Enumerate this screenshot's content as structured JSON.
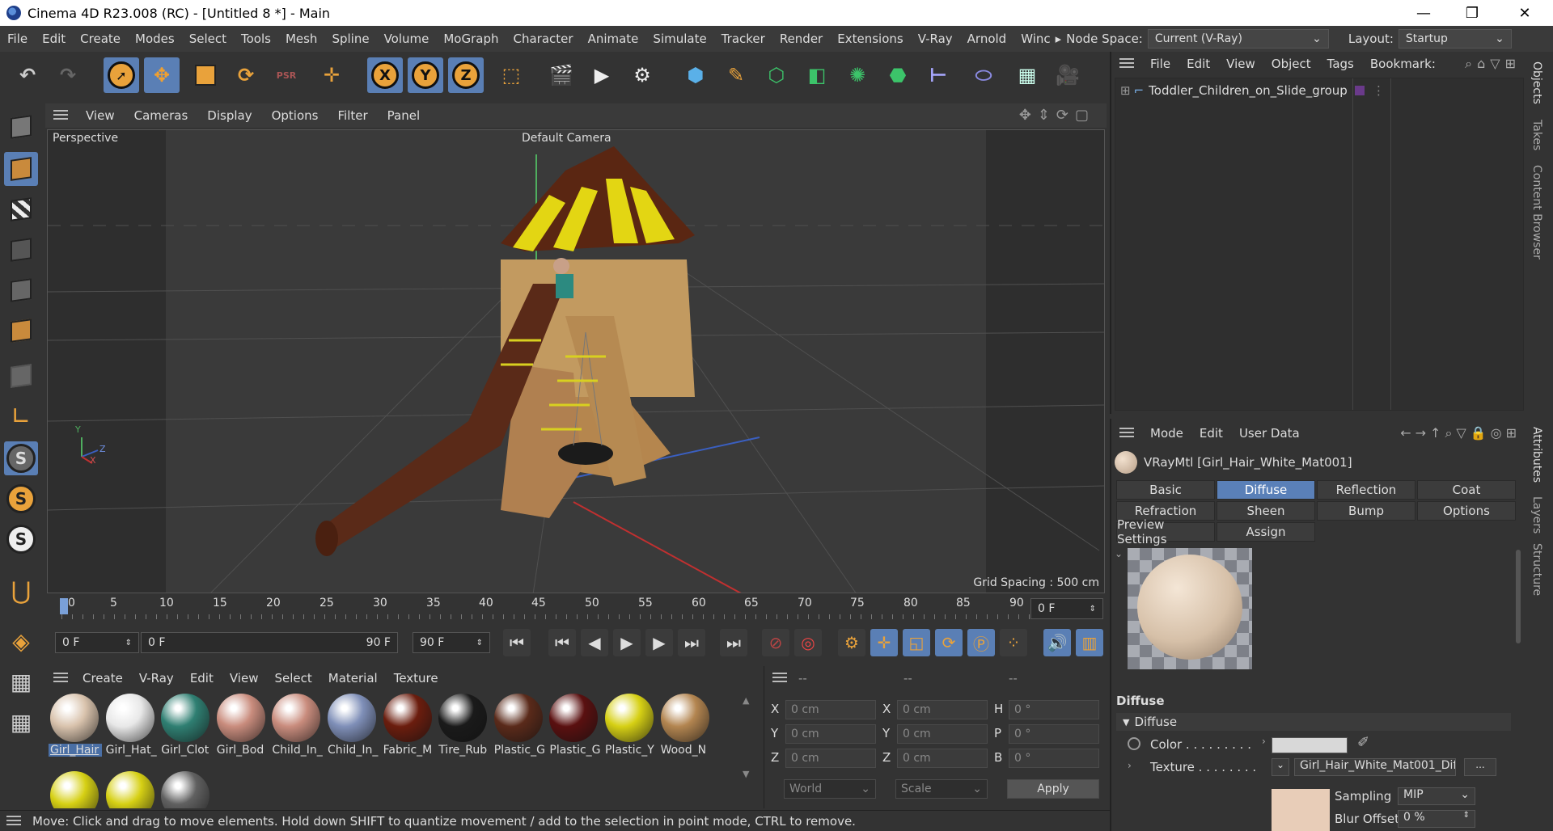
{
  "title_bar": {
    "title": "Cinema 4D R23.008 (RC) - [Untitled 8 *] - Main",
    "minimize": "—",
    "maximize": "❐",
    "close": "✕"
  },
  "menu": {
    "items": [
      "File",
      "Edit",
      "Create",
      "Modes",
      "Select",
      "Tools",
      "Mesh",
      "Spline",
      "Volume",
      "MoGraph",
      "Character",
      "Animate",
      "Simulate",
      "Tracker",
      "Render",
      "Extensions",
      "V-Ray",
      "Arnold",
      "Winc"
    ],
    "overflow": "▸",
    "node_space_label": "Node Space:",
    "node_space_value": "Current (V-Ray)",
    "layout_label": "Layout:",
    "layout_value": "Startup"
  },
  "toolbar": {
    "x_axis": "X",
    "y_axis": "Y",
    "z_axis": "Z",
    "psr": "PSR"
  },
  "viewport": {
    "menu": [
      "View",
      "Cameras",
      "Display",
      "Options",
      "Filter",
      "Panel"
    ],
    "view_name": "Perspective",
    "camera": "Default Camera",
    "grid_spacing": "Grid Spacing : 500 cm",
    "axis_y": "Y",
    "axis_x": "X",
    "axis_z": "Z"
  },
  "timeline": {
    "ticks": [
      "0",
      "5",
      "10",
      "15",
      "20",
      "25",
      "30",
      "35",
      "40",
      "45",
      "50",
      "55",
      "60",
      "65",
      "70",
      "75",
      "80",
      "85",
      "90"
    ],
    "current_frame": "0 F",
    "start_field": "0 F",
    "range_start": "0 F",
    "range_end": "90 F",
    "end_field": "90 F"
  },
  "material_manager": {
    "menu": [
      "Create",
      "V-Ray",
      "Edit",
      "View",
      "Select",
      "Material",
      "Texture"
    ],
    "materials": [
      {
        "label": "Girl_Hair",
        "color": "#d9c3ad",
        "selected": true
      },
      {
        "label": "Girl_Hat_",
        "color": "#e8e8e8"
      },
      {
        "label": "Girl_Clot",
        "color": "#2f7f72"
      },
      {
        "label": "Girl_Bod",
        "color": "#c98c7d"
      },
      {
        "label": "Child_In_",
        "color": "#c98c7d"
      },
      {
        "label": "Child_In_",
        "color": "#7f8fb8"
      },
      {
        "label": "Fabric_M",
        "color": "#6b1d0e"
      },
      {
        "label": "Tire_Rub",
        "color": "#1a1a1a"
      },
      {
        "label": "Plastic_G",
        "color": "#5a2a1a"
      },
      {
        "label": "Plastic_G",
        "color": "#5a1010"
      },
      {
        "label": "Plastic_Y",
        "color": "#d6d014"
      },
      {
        "label": "Wood_N",
        "color": "#b38550"
      },
      {
        "label": "",
        "color": "#d6d014"
      },
      {
        "label": "",
        "color": "#d6d014"
      },
      {
        "label": "",
        "color": "#606060"
      }
    ]
  },
  "coordinates": {
    "headers": [
      "--",
      "--",
      "--"
    ],
    "rows": [
      {
        "l1": "X",
        "v1": "0 cm",
        "l2": "X",
        "v2": "0 cm",
        "l3": "H",
        "v3": "0 °"
      },
      {
        "l1": "Y",
        "v1": "0 cm",
        "l2": "Y",
        "v2": "0 cm",
        "l3": "P",
        "v3": "0 °"
      },
      {
        "l1": "Z",
        "v1": "0 cm",
        "l2": "Z",
        "v2": "0 cm",
        "l3": "B",
        "v3": "0 °"
      }
    ],
    "world": "World",
    "scale": "Scale",
    "apply": "Apply"
  },
  "status_bar": "Move: Click and drag to move elements. Hold down SHIFT to quantize movement / add to the selection in point mode, CTRL to remove.",
  "object_manager": {
    "menu": [
      "File",
      "Edit",
      "View",
      "Object",
      "Tags",
      "Bookmark:"
    ],
    "objects": [
      {
        "name": "Toddler_Children_on_Slide_group"
      }
    ]
  },
  "attributes": {
    "menu": [
      "Mode",
      "Edit",
      "User Data"
    ],
    "material_title": "VRayMtl [Girl_Hair_White_Mat001]",
    "tabs_row1": [
      "Basic",
      "Diffuse",
      "Reflection",
      "Coat"
    ],
    "tabs_row2": [
      "Refraction",
      "Sheen",
      "Bump",
      "Options"
    ],
    "tabs_row3": [
      "Preview Settings",
      "Assign"
    ],
    "active_tab": "Diffuse",
    "section_title": "Diffuse",
    "group_title": "Diffuse",
    "color_label": "Color . . . . . . . . .",
    "texture_label": "Texture . . . . . . . .",
    "texture_value": "Girl_Hair_White_Mat001_Dif",
    "texture_more": "...",
    "sampling_label": "Sampling",
    "sampling_value": "MIP",
    "blur_label": "Blur Offset",
    "blur_value": "0 %",
    "color_swatch": "#d8d8d8"
  },
  "side_tabs": [
    "Objects",
    "Takes",
    "Content Browser",
    "Attributes",
    "Layers",
    "Structure"
  ]
}
